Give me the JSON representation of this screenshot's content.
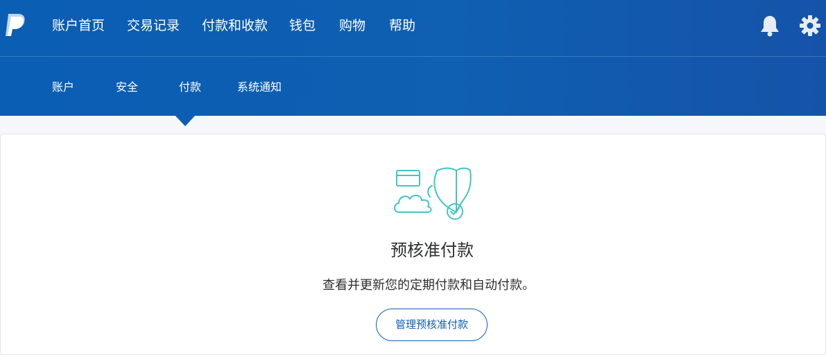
{
  "header": {
    "logo_icon": "paypal-logo",
    "nav": [
      {
        "label": "账户首页"
      },
      {
        "label": "交易记录"
      },
      {
        "label": "付款和收款"
      },
      {
        "label": "钱包"
      },
      {
        "label": "购物"
      },
      {
        "label": "帮助"
      }
    ],
    "icons": {
      "notifications": "bell-icon",
      "settings": "gear-icon"
    },
    "colors": {
      "bar": "#0f5fb2",
      "text": "#ffffff"
    }
  },
  "subnav": {
    "items": [
      {
        "label": "账户"
      },
      {
        "label": "安全"
      },
      {
        "label": "付款",
        "active": true
      },
      {
        "label": "系统通知"
      }
    ]
  },
  "main": {
    "illustration": "card-cloud-shield-check-icon",
    "title": "预核准付款",
    "description": "查看并更新您的定期付款和自动付款。",
    "manage_button": "管理预核准付款",
    "colors": {
      "accent": "#0e5eb3",
      "illustration": "#3ec6c2"
    }
  }
}
